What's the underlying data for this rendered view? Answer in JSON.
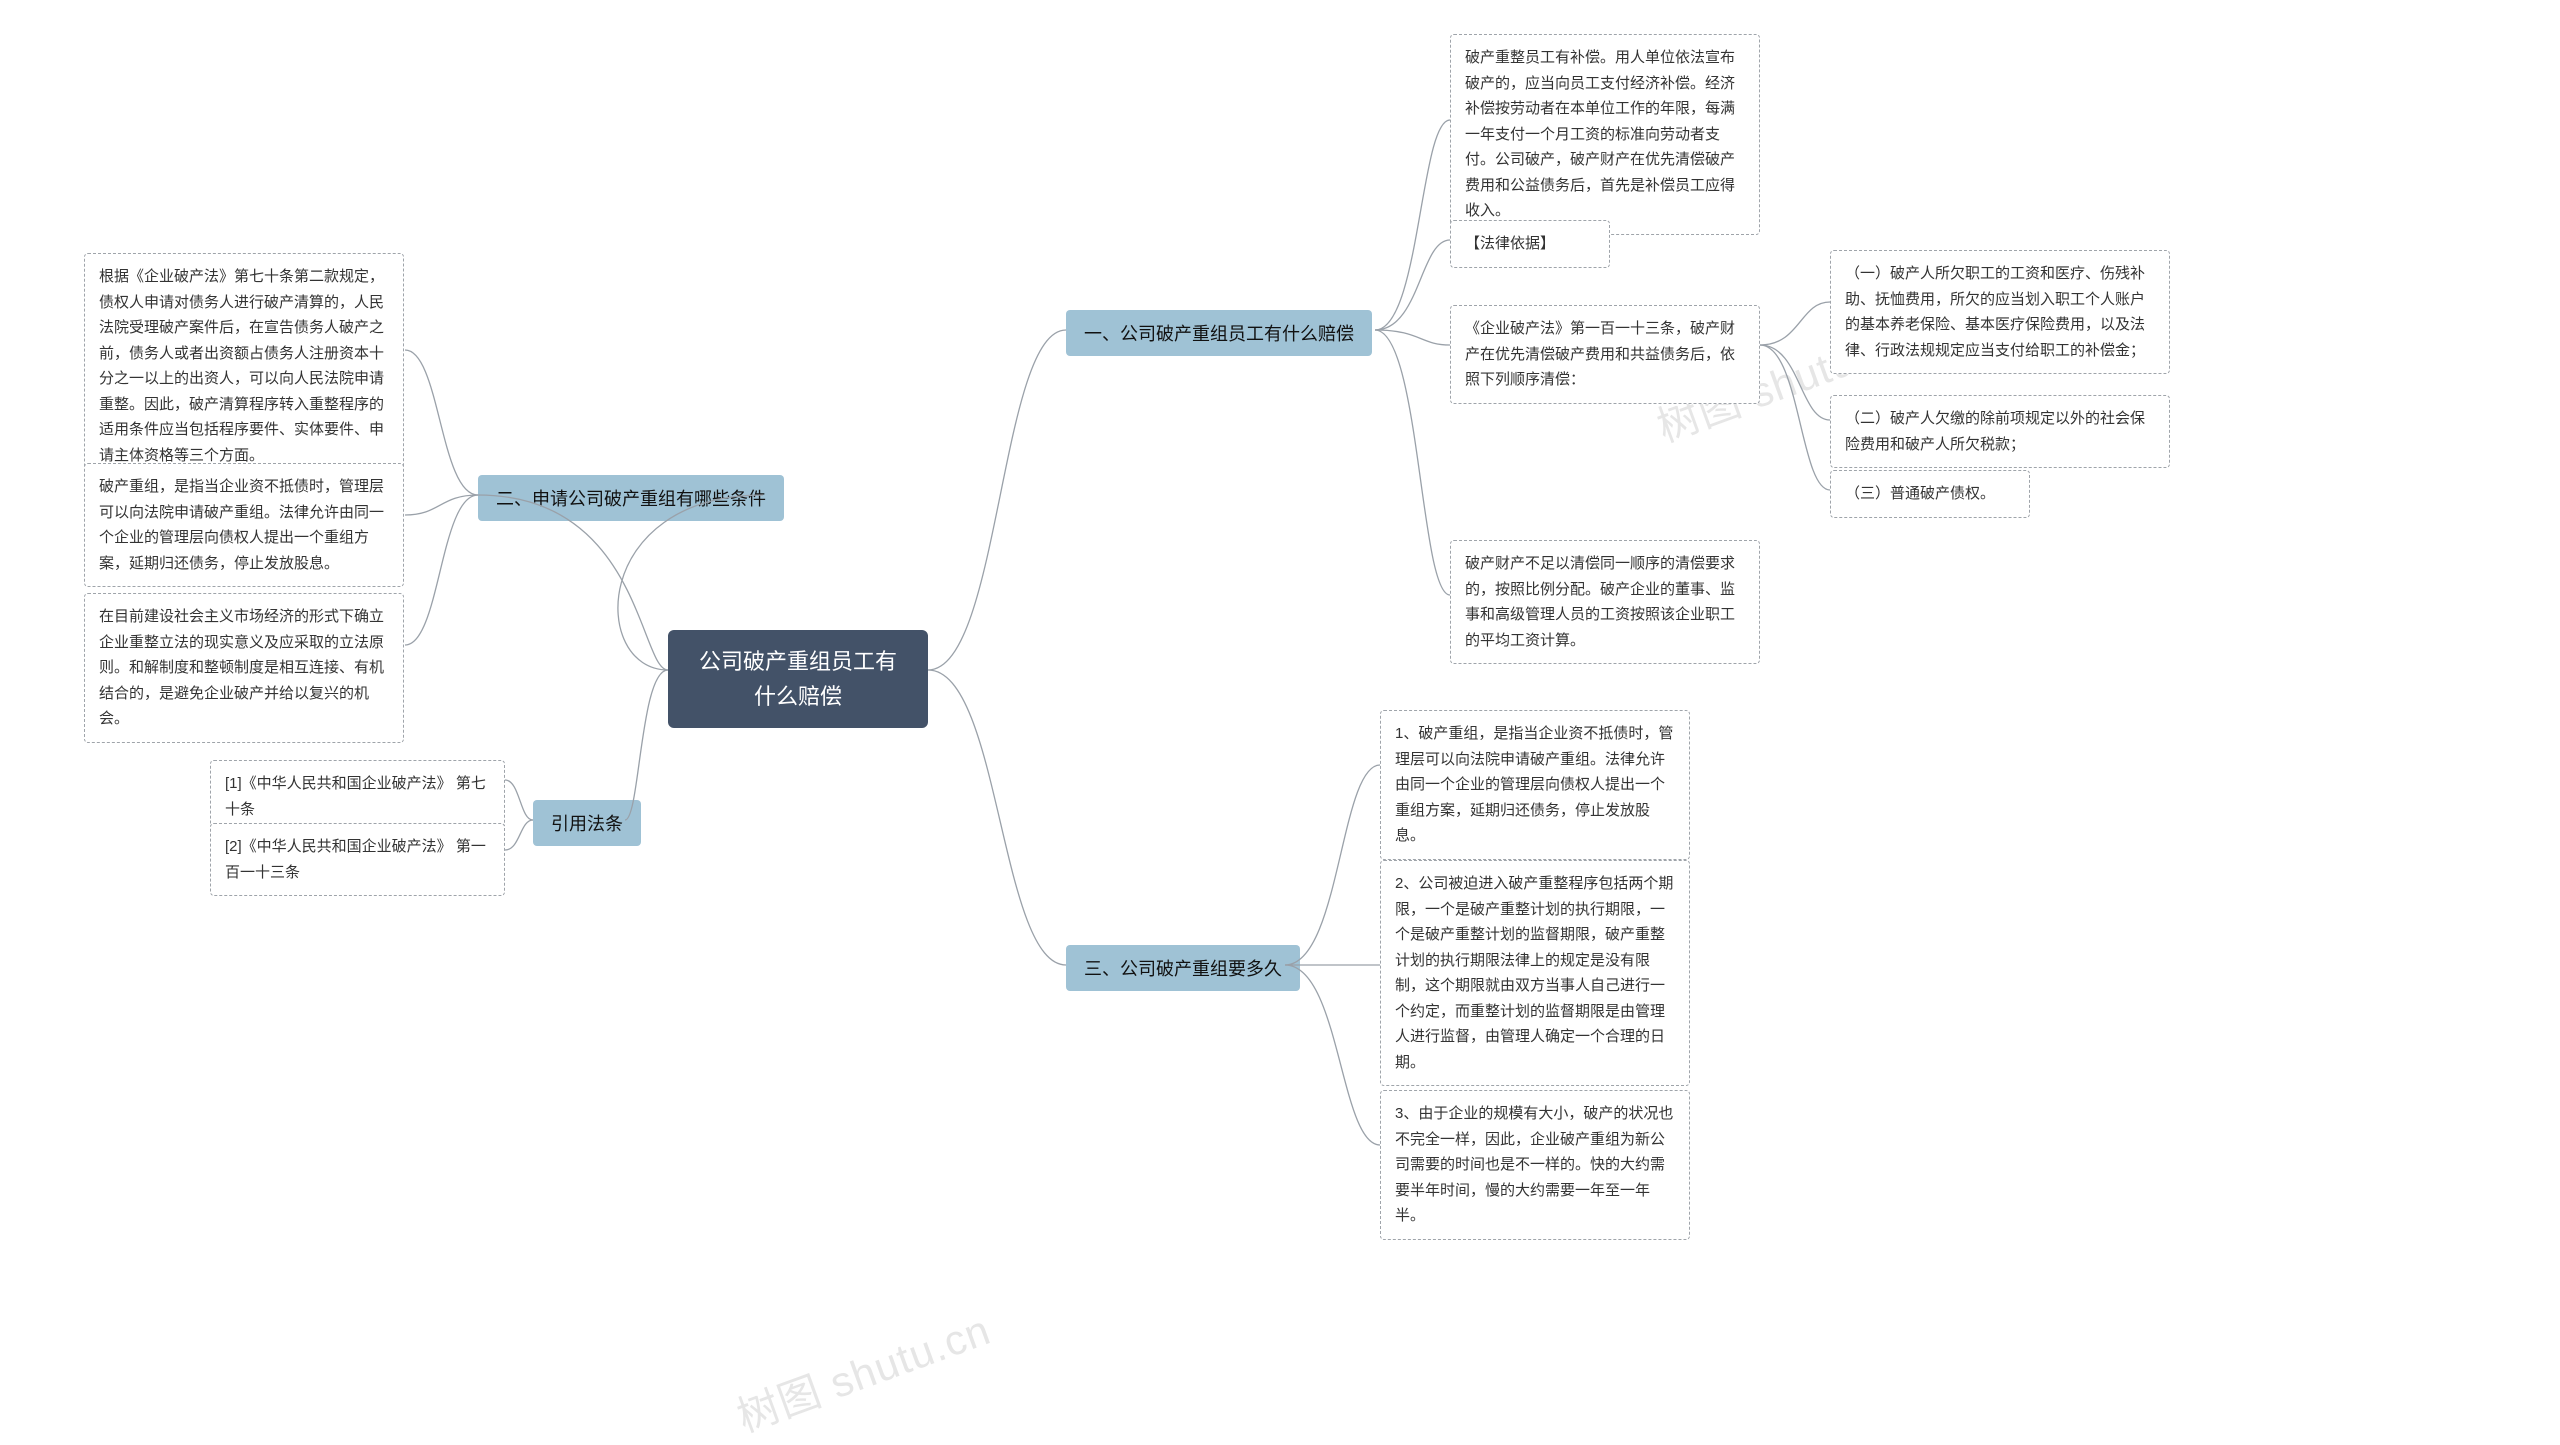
{
  "root": "公司破产重组员工有什么赔偿",
  "branches": {
    "b1": {
      "title": "一、公司破产重组员工有什么赔偿",
      "leaves": {
        "l1": "破产重整员工有补偿。用人单位依法宣布破产的，应当向员工支付经济补偿。经济补偿按劳动者在本单位工作的年限，每满一年支付一个月工资的标准向劳动者支付。公司破产，破产财产在优先清偿破产费用和公益债务后，首先是补偿员工应得收入。",
        "l2": "【法律依据】",
        "l3": "《企业破产法》第一百一十三条，破产财产在优先清偿破产费用和共益债务后，依照下列顺序清偿：",
        "l3a": "（一）破产人所欠职工的工资和医疗、伤残补助、抚恤费用，所欠的应当划入职工个人账户的基本养老保险、基本医疗保险费用，以及法律、行政法规规定应当支付给职工的补偿金；",
        "l3b": "（二）破产人欠缴的除前项规定以外的社会保险费用和破产人所欠税款；",
        "l3c": "（三）普通破产债权。",
        "l4": "破产财产不足以清偿同一顺序的清偿要求的，按照比例分配。破产企业的董事、监事和高级管理人员的工资按照该企业职工的平均工资计算。"
      }
    },
    "b2": {
      "title": "二、申请公司破产重组有哪些条件",
      "leaves": {
        "l1": "根据《企业破产法》第七十条第二款规定，债权人申请对债务人进行破产清算的，人民法院受理破产案件后，在宣告债务人破产之前，债务人或者出资额占债务人注册资本十分之一以上的出资人，可以向人民法院申请重整。因此，破产清算程序转入重整程序的适用条件应当包括程序要件、实体要件、申请主体资格等三个方面。",
        "l2": "破产重组，是指当企业资不抵债时，管理层可以向法院申请破产重组。法律允许由同一个企业的管理层向债权人提出一个重组方案，延期归还债务，停止发放股息。",
        "l3": "在目前建设社会主义市场经济的形式下确立企业重整立法的现实意义及应采取的立法原则。和解制度和整顿制度是相互连接、有机结合的，是避免企业破产并给以复兴的机会。"
      }
    },
    "b3": {
      "title": "三、公司破产重组要多久",
      "leaves": {
        "l1": "1、破产重组，是指当企业资不抵债时，管理层可以向法院申请破产重组。法律允许由同一个企业的管理层向债权人提出一个重组方案，延期归还债务，停止发放股息。",
        "l2": "2、公司被迫进入破产重整程序包括两个期限，一个是破产重整计划的执行期限，一个是破产重整计划的监督期限，破产重整计划的执行期限法律上的规定是没有限制，这个期限就由双方当事人自己进行一个约定，而重整计划的监督期限是由管理人进行监督，由管理人确定一个合理的日期。",
        "l3": "3、由于企业的规模有大小，破产的状况也不完全一样，因此，企业破产重组为新公司需要的时间也是不一样的。快的大约需要半年时间，慢的大约需要一年至一年半。"
      }
    },
    "b4": {
      "title": "引用法条",
      "leaves": {
        "l1": "[1]《中华人民共和国企业破产法》 第七十条",
        "l2": "[2]《中华人民共和国企业破产法》 第一百一十三条"
      }
    }
  },
  "watermarks": {
    "w1": "树图 shutu.cn",
    "w2": "树图 shutu.cn",
    "w3": "树图 shutu.cn"
  }
}
